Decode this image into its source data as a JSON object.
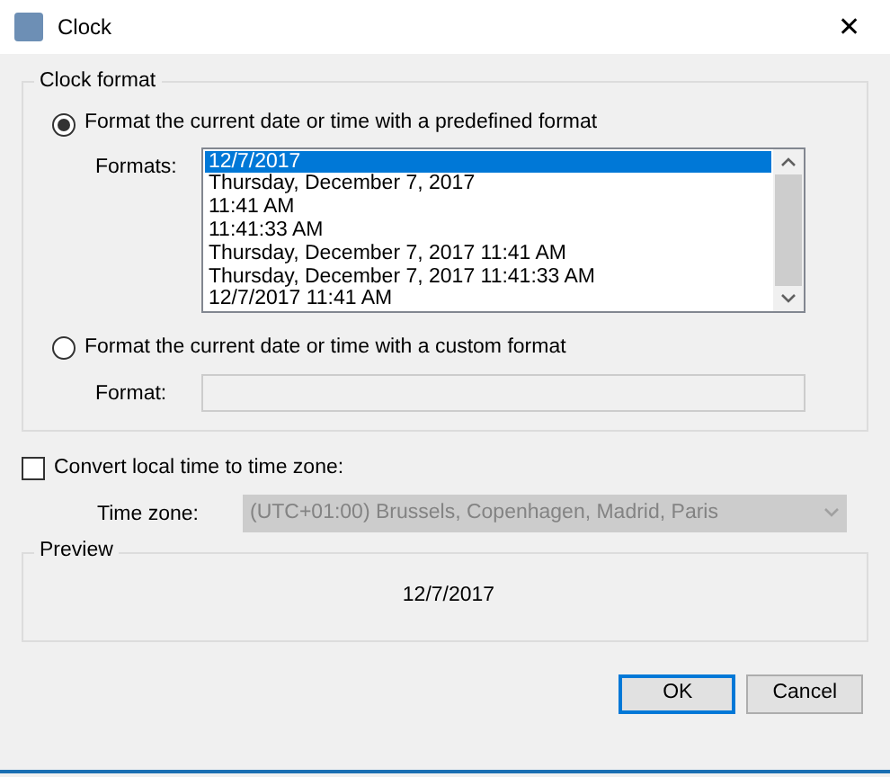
{
  "window": {
    "title": "Clock",
    "close": "✕"
  },
  "clock_format": {
    "label": "Clock format",
    "options": [
      {
        "kind": "list",
        "label": "Format the current date or time with a predefined format",
        "selected": true,
        "field_label": "Formats:",
        "items": [
          {
            "text": "12/7/2017",
            "selected": true
          },
          {
            "text": "Thursday, December 7, 2017",
            "selected": false
          },
          {
            "text": "11:41 AM",
            "selected": false
          },
          {
            "text": "11:41:33 AM",
            "selected": false
          },
          {
            "text": "Thursday, December 7, 2017 11:41 AM",
            "selected": false
          },
          {
            "text": "Thursday, December 7, 2017 11:41:33 AM",
            "selected": false
          },
          {
            "text": "12/7/2017 11:41 AM",
            "selected": false
          }
        ]
      },
      {
        "kind": "text",
        "label": "Format the current date or time with a custom format",
        "selected": false,
        "field_label": "Format:",
        "disabled": true
      }
    ]
  },
  "time_zone": {
    "label": "Convert local time to time zone:",
    "checked": false,
    "field_label": "Time zone:",
    "value": "(UTC+01:00) Brussels, Copenhagen, Madrid, Paris",
    "disabled": true
  },
  "preview": {
    "label": "Preview",
    "text": "12/7/2017"
  },
  "buttons": [
    {
      "label": "OK",
      "default": true
    },
    {
      "label": "Cancel",
      "default": false
    }
  ]
}
